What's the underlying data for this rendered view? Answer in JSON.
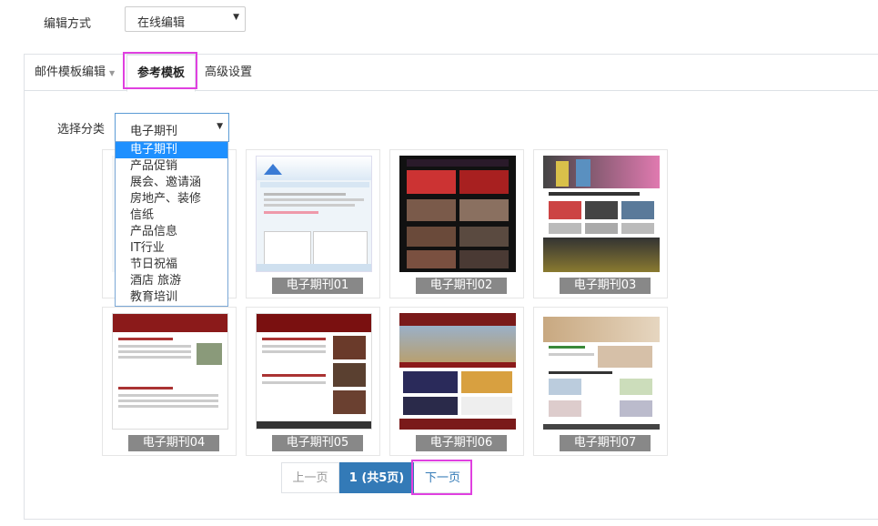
{
  "edit_mode": {
    "label": "编辑方式",
    "value": "在线编辑"
  },
  "tabs": [
    {
      "label": "邮件模板编辑"
    },
    {
      "label": "参考模板"
    },
    {
      "label": "高级设置"
    }
  ],
  "category": {
    "label": "选择分类",
    "value": "电子期刊",
    "options": [
      "电子期刊",
      "产品促销",
      "展会、邀请涵",
      "房地产、装修",
      "信纸",
      "产品信息",
      "IT行业",
      "节日祝福",
      "酒店 旅游",
      "教育培训"
    ]
  },
  "templates": [
    {
      "caption": "电子期刊01"
    },
    {
      "caption": "电子期刊02"
    },
    {
      "caption": "电子期刊03"
    },
    {
      "caption": "电子期刊04"
    },
    {
      "caption": "电子期刊05"
    },
    {
      "caption": "电子期刊06"
    },
    {
      "caption": "电子期刊07"
    }
  ],
  "pagination": {
    "prev": "上一页",
    "current": "1  (共5页)",
    "next": "下一页"
  },
  "colors": {
    "accent": "#337ab7",
    "highlight": "#e040e0",
    "selected_option": "#1e90ff"
  }
}
